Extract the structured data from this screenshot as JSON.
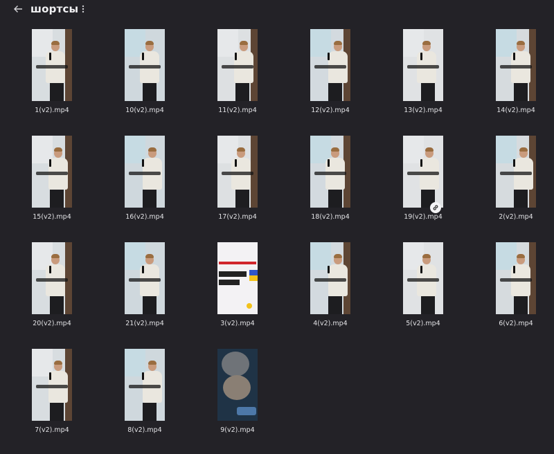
{
  "header": {
    "back_icon": "arrow-left-icon",
    "title": "шортсы",
    "more_icon": "more-vertical-icon"
  },
  "files": [
    {
      "name": "1(v2).mp4",
      "kind": "speaker"
    },
    {
      "name": "10(v2).mp4",
      "kind": "speaker"
    },
    {
      "name": "11(v2).mp4",
      "kind": "speaker"
    },
    {
      "name": "12(v2).mp4",
      "kind": "speaker"
    },
    {
      "name": "13(v2).mp4",
      "kind": "speaker"
    },
    {
      "name": "14(v2).mp4",
      "kind": "speaker"
    },
    {
      "name": "15(v2).mp4",
      "kind": "speaker"
    },
    {
      "name": "16(v2).mp4",
      "kind": "speaker"
    },
    {
      "name": "17(v2).mp4",
      "kind": "speaker"
    },
    {
      "name": "18(v2).mp4",
      "kind": "speaker"
    },
    {
      "name": "19(v2).mp4",
      "kind": "speaker",
      "badge": "link-icon"
    },
    {
      "name": "2(v2).mp4",
      "kind": "speaker"
    },
    {
      "name": "20(v2).mp4",
      "kind": "speaker"
    },
    {
      "name": "21(v2).mp4",
      "kind": "speaker"
    },
    {
      "name": "3(v2).mp4",
      "kind": "promo"
    },
    {
      "name": "4(v2).mp4",
      "kind": "speaker"
    },
    {
      "name": "5(v2).mp4",
      "kind": "speaker"
    },
    {
      "name": "6(v2).mp4",
      "kind": "speaker"
    },
    {
      "name": "7(v2).mp4",
      "kind": "speaker"
    },
    {
      "name": "8(v2).mp4",
      "kind": "speaker"
    },
    {
      "name": "9(v2).mp4",
      "kind": "chat"
    }
  ],
  "colors": {
    "background": "#232227",
    "text": "#e3e3e6"
  }
}
